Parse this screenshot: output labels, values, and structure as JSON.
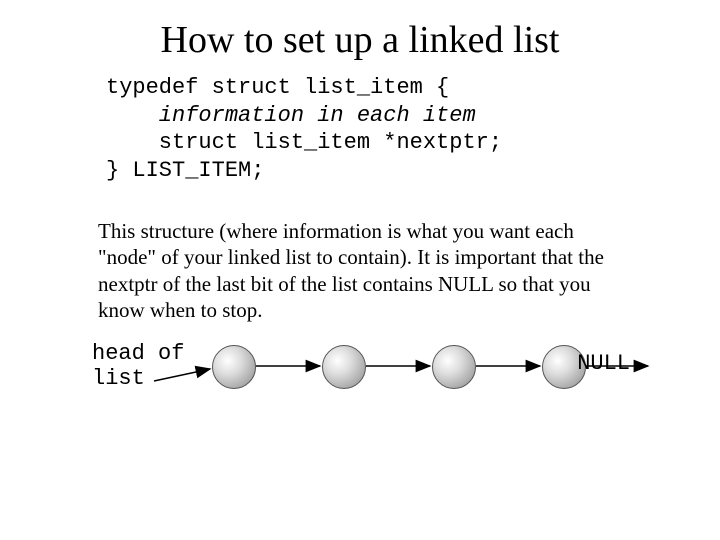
{
  "title": "How to set up a linked list",
  "code": {
    "l1": "typedef struct list_item {",
    "l2": "    information in each item",
    "l3": "    struct list_item *nextptr;",
    "l4": "} LIST_ITEM;"
  },
  "paragraph": "This structure (where information is what you want each \"node\" of your linked list to contain).  It is important that the nextptr of the last bit of the list contains NULL so that you know when to stop.",
  "diagram": {
    "head_label_line1": "head of",
    "head_label_line2": "list",
    "null_label": "NULL",
    "node_count": 4
  }
}
